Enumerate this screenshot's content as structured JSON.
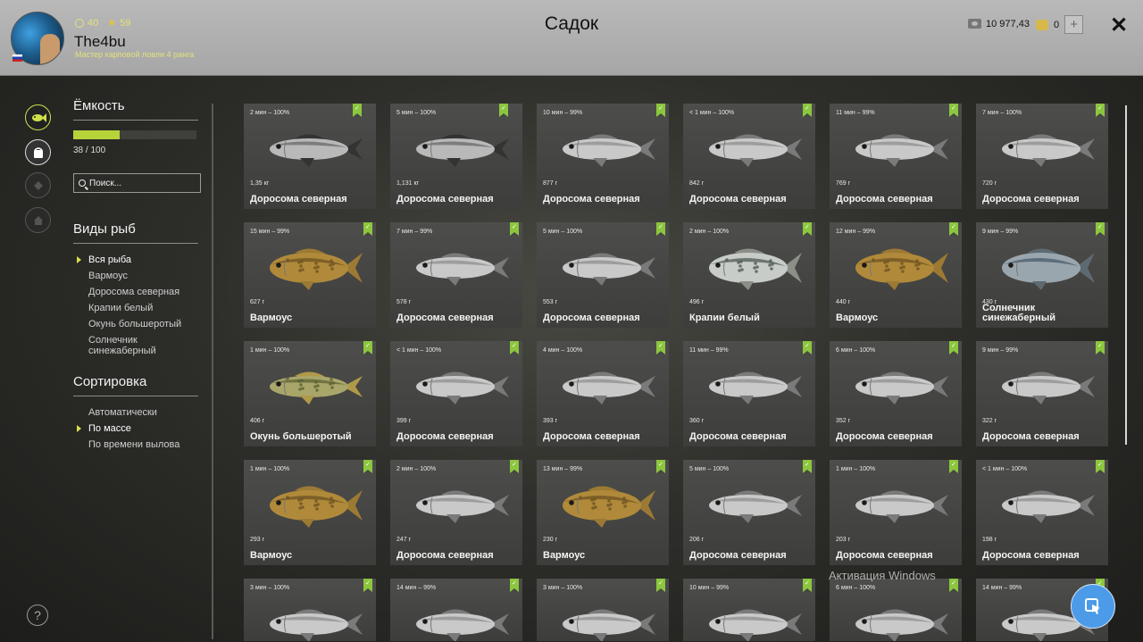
{
  "header": {
    "title": "Садок",
    "username": "The4bu",
    "rank": "Мастер карповой ловли 4 ранга",
    "level": "40",
    "stars": "59",
    "money": "10 977,43",
    "gold": "0",
    "plus_label": "+",
    "close_label": "✕"
  },
  "sidebar": {
    "capacity_title": "Ёмкость",
    "capacity_count": "38 / 100",
    "capacity_fraction": 0.38,
    "search_placeholder": "Поиск...",
    "species_title": "Виды рыб",
    "species": [
      {
        "label": "Вся рыба",
        "selected": true
      },
      {
        "label": "Вармоус",
        "selected": false
      },
      {
        "label": "Доросома северная",
        "selected": false
      },
      {
        "label": "Крапии белый",
        "selected": false
      },
      {
        "label": "Окунь большеротый",
        "selected": false
      },
      {
        "label": "Солнечник синежаберный",
        "selected": false
      }
    ],
    "sort_title": "Сортировка",
    "sort": [
      {
        "label": "Автоматически",
        "selected": false
      },
      {
        "label": "По массе",
        "selected": true
      },
      {
        "label": "По времени вылова",
        "selected": false
      }
    ]
  },
  "fish_cards": [
    {
      "time": "2 мин – 100%",
      "weight": "1,35 кг",
      "name": "Доросома северная",
      "fish": "shad-dark",
      "gold": true
    },
    {
      "time": "5 мин – 100%",
      "weight": "1,131 кг",
      "name": "Доросома северная",
      "fish": "shad-dark",
      "gold": true
    },
    {
      "time": "10 мин – 99%",
      "weight": "877 г",
      "name": "Доросома северная",
      "fish": "shad"
    },
    {
      "time": "< 1 мин – 100%",
      "weight": "842 г",
      "name": "Доросома северная",
      "fish": "shad"
    },
    {
      "time": "11 мин – 99%",
      "weight": "769 г",
      "name": "Доросома северная",
      "fish": "shad"
    },
    {
      "time": "7 мин – 100%",
      "weight": "720 г",
      "name": "Доросома северная",
      "fish": "shad"
    },
    {
      "time": "15 мин – 99%",
      "weight": "627 г",
      "name": "Вармоус",
      "fish": "warmouth"
    },
    {
      "time": "7 мин – 99%",
      "weight": "578 г",
      "name": "Доросома северная",
      "fish": "shad"
    },
    {
      "time": "5 мин – 100%",
      "weight": "553 г",
      "name": "Доросома северная",
      "fish": "shad"
    },
    {
      "time": "2 мин – 100%",
      "weight": "496 г",
      "name": "Крапии белый",
      "fish": "crappie"
    },
    {
      "time": "12 мин – 99%",
      "weight": "440 г",
      "name": "Вармоус",
      "fish": "warmouth"
    },
    {
      "time": "9 мин – 99%",
      "weight": "430 г",
      "name": "Солнечник синежаберный",
      "fish": "bluegill"
    },
    {
      "time": "1 мин – 100%",
      "weight": "406 г",
      "name": "Окунь большеротый",
      "fish": "bass"
    },
    {
      "time": "< 1 мин – 100%",
      "weight": "399 г",
      "name": "Доросома северная",
      "fish": "shad"
    },
    {
      "time": "4 мин – 100%",
      "weight": "393 г",
      "name": "Доросома северная",
      "fish": "shad"
    },
    {
      "time": "11 мин – 99%",
      "weight": "360 г",
      "name": "Доросома северная",
      "fish": "shad"
    },
    {
      "time": "6 мин – 100%",
      "weight": "352 г",
      "name": "Доросома северная",
      "fish": "shad"
    },
    {
      "time": "9 мин – 99%",
      "weight": "322 г",
      "name": "Доросома северная",
      "fish": "shad"
    },
    {
      "time": "1 мин – 100%",
      "weight": "293 г",
      "name": "Вармоус",
      "fish": "warmouth"
    },
    {
      "time": "2 мин – 100%",
      "weight": "247 г",
      "name": "Доросома северная",
      "fish": "shad"
    },
    {
      "time": "13 мин – 99%",
      "weight": "230 г",
      "name": "Вармоус",
      "fish": "warmouth"
    },
    {
      "time": "5 мин – 100%",
      "weight": "206 г",
      "name": "Доросома северная",
      "fish": "shad"
    },
    {
      "time": "1 мин – 100%",
      "weight": "203 г",
      "name": "Доросома северная",
      "fish": "shad"
    },
    {
      "time": "< 1 мин – 100%",
      "weight": "198 г",
      "name": "Доросома северная",
      "fish": "shad"
    },
    {
      "time": "3 мин – 100%",
      "weight": "",
      "name": "",
      "fish": "shad"
    },
    {
      "time": "14 мин – 99%",
      "weight": "",
      "name": "",
      "fish": "shad"
    },
    {
      "time": "3 мин – 100%",
      "weight": "",
      "name": "",
      "fish": "shad"
    },
    {
      "time": "10 мин – 99%",
      "weight": "",
      "name": "",
      "fish": "shad"
    },
    {
      "time": "6 мин – 100%",
      "weight": "",
      "name": "",
      "fish": "shad"
    },
    {
      "time": "14 мин – 99%",
      "weight": "",
      "name": "",
      "fish": "shad"
    }
  ],
  "fish_colors": {
    "shad": {
      "body": "#c9c9c9",
      "back": "#8e8e8e",
      "fin": "#7a7a7a"
    },
    "shad-dark": {
      "body": "#b9b9b9",
      "back": "#6a6a6a",
      "fin": "#333333"
    },
    "warmouth": {
      "body": "#b08a3a",
      "back": "#6e5222",
      "fin": "#9c7a34"
    },
    "crappie": {
      "body": "#c8ccc8",
      "back": "#4f5a54",
      "fin": "#8a8f88"
    },
    "bluegill": {
      "body": "#9aa6ae",
      "back": "#4a5a68",
      "fin": "#5e6a72"
    },
    "bass": {
      "body": "#a9a66a",
      "back": "#5d6234",
      "fin": "#b09a4a"
    }
  },
  "watermark": {
    "title": "Активация Windows"
  },
  "help_label": "?"
}
